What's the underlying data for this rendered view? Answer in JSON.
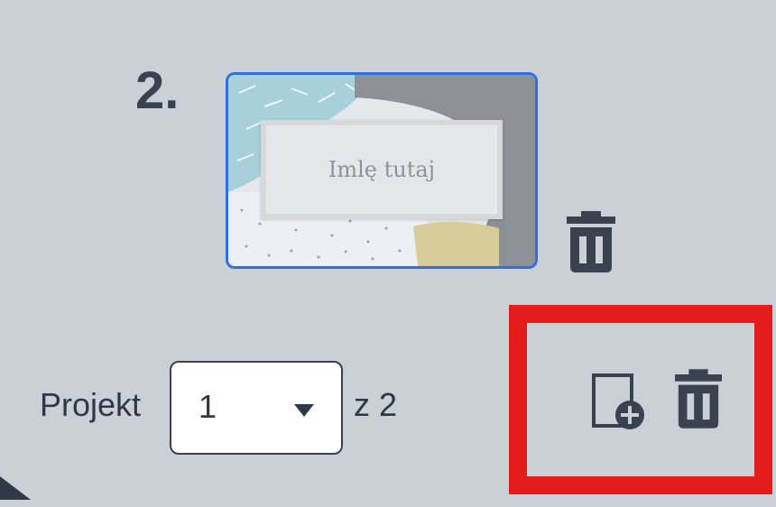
{
  "page": {
    "number_label": "2."
  },
  "thumbnail": {
    "placeholder_text": "Imlę tutaj"
  },
  "project": {
    "label": "Projekt",
    "selected": "1",
    "total": "z 2"
  },
  "icons": {
    "delete_page": "trash-icon",
    "add_page": "add-page-icon",
    "delete_project": "trash-icon"
  },
  "colors": {
    "background": "#cbd0d7",
    "selection_border": "#2f6fe0",
    "highlight": "#e41c1c",
    "icon": "#3a4250"
  }
}
